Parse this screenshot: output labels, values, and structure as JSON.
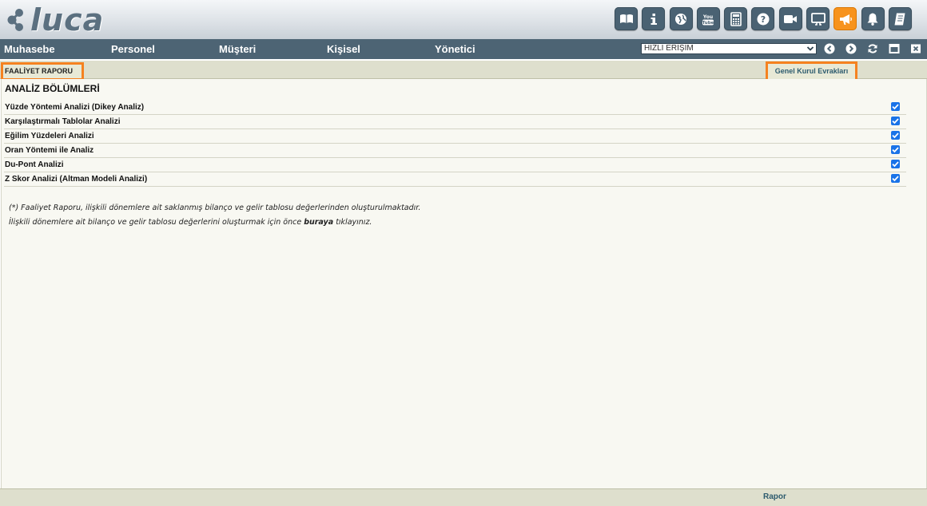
{
  "app": {
    "logo_text": "luca",
    "brand_color": "#4d6474",
    "accent_color": "#f58220"
  },
  "toolbar": {
    "icons": [
      "book-icon",
      "info-icon",
      "globe-icon",
      "youtube-icon",
      "calculator-icon",
      "help-icon",
      "video-icon",
      "monitor-icon",
      "megaphone-icon",
      "bell-icon",
      "notebook-icon"
    ],
    "active_icon": "megaphone-icon"
  },
  "menu": {
    "items": [
      {
        "label": "Muhasebe"
      },
      {
        "label": "Personel"
      },
      {
        "label": "Müşteri"
      },
      {
        "label": "Kişisel"
      },
      {
        "label": "Yönetici"
      }
    ],
    "quick_access": {
      "value": "HIZLI ERİŞİM"
    }
  },
  "tabs": {
    "active": "FAALİYET RAPORU",
    "right_link": "Genel Kurul Evrakları"
  },
  "section": {
    "title": "ANALİZ BÖLÜMLERİ",
    "rows": [
      {
        "label": "Yüzde Yöntemi Analizi (Dikey Analiz)",
        "checked": true
      },
      {
        "label": "Karşılaştırmalı Tablolar Analizi",
        "checked": true
      },
      {
        "label": "Eğilim Yüzdeleri Analizi",
        "checked": true
      },
      {
        "label": "Oran Yöntemi ile Analiz",
        "checked": true
      },
      {
        "label": "Du-Pont Analizi",
        "checked": true
      },
      {
        "label": "Z Skor Analizi (Altman Modeli Analizi)",
        "checked": true
      }
    ]
  },
  "notes": {
    "line1": "(*) Faaliyet Raporu, ilişkili dönemlere ait saklanmış bilanço ve gelir tablosu değerlerinden oluşturulmaktadır.",
    "line2_prefix": "İlişkili dönemlere ait bilanço ve gelir tablosu değerlerini oluşturmak için önce ",
    "line2_link": "buraya",
    "line2_suffix": " tıklayınız."
  },
  "footer": {
    "action": "Rapor"
  }
}
